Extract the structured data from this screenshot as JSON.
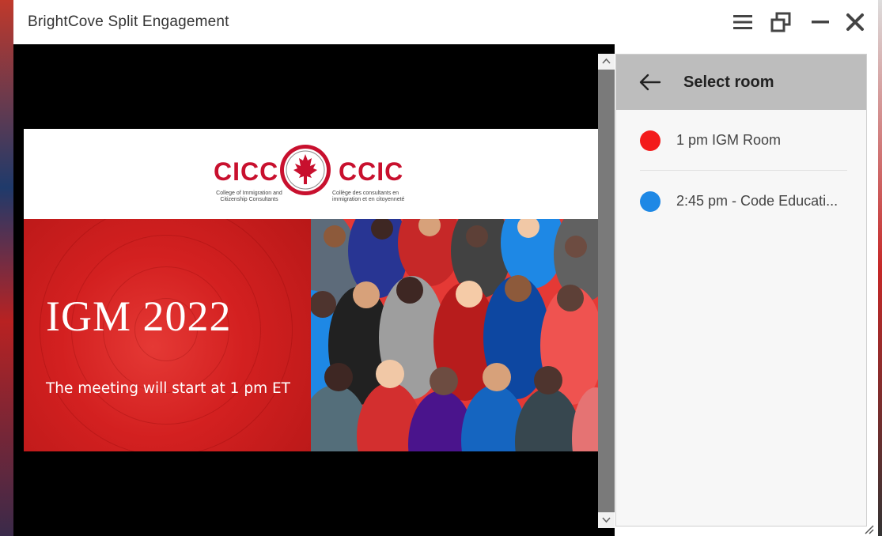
{
  "window": {
    "title": "BrightCove Split Engagement",
    "icons": [
      "menu-icon",
      "restore-icon",
      "minimize-icon",
      "close-icon"
    ]
  },
  "slide": {
    "logo": {
      "acronym_en": "CICC",
      "acronym_fr": "CCIC",
      "name_en": "College of Immigration and Citizenship Consultants",
      "name_fr": "Collège des consultants en immigration et en citoyenneté"
    },
    "title": "IGM 2022",
    "subtitle": "The meeting will start at 1 pm ET"
  },
  "panel": {
    "title": "Select room",
    "back_icon": "arrow-left-icon",
    "rooms": [
      {
        "label": "1 pm IGM Room",
        "color": "#f31b1b"
      },
      {
        "label": "2:45 pm - Code Educati...",
        "color": "#1e88e5"
      }
    ]
  },
  "colors": {
    "brand_red": "#c8102e",
    "panel_header": "#bdbdbd",
    "video_bg": "#000000"
  }
}
